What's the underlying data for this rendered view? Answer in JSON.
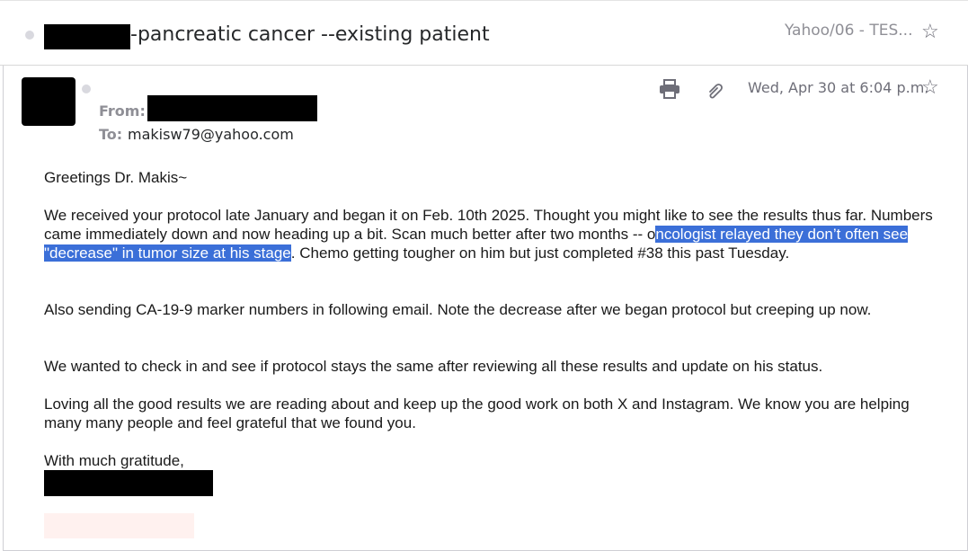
{
  "thread": {
    "subject": "-pancreatic cancer --existing patient",
    "folder": "Yahoo/06 - TES..."
  },
  "message": {
    "from_label": "From:",
    "to_label": "To:",
    "to_address": "makisw79@yahoo.com",
    "date": "Wed, Apr 30 at 6:04 p.m."
  },
  "body": {
    "greeting": "Greetings Dr. Makis~",
    "p1_before": "We received your protocol late January and began it on Feb. 10th 2025.  Thought you might like to see the results thus far. Numbers came immediately down and now heading up a bit. Scan much better after two months -- o",
    "p1_highlight": "ncologist relayed they don’t often see \"decrease\" in tumor size at his stage",
    "p1_after": ". Chemo getting tougher on him but just completed #38 this past Tuesday.",
    "p2": "Also sending CA-19-9 marker numbers in following email. Note the decrease after we began protocol  but creeping up now.",
    "p3": "We wanted to check in and see if protocol stays the same after reviewing all these results and update on his status.",
    "p4": "Loving all the good results we are reading about and keep up the good work on both X and Instagram. We know you are helping many many people and feel grateful that we found you.",
    "signoff": "With much gratitude,"
  },
  "colors": {
    "highlight": "#3b6fd8",
    "muted": "#8f8f96",
    "redaction": "#000000"
  },
  "icons": [
    "star-icon",
    "print-icon",
    "attachment-icon"
  ]
}
